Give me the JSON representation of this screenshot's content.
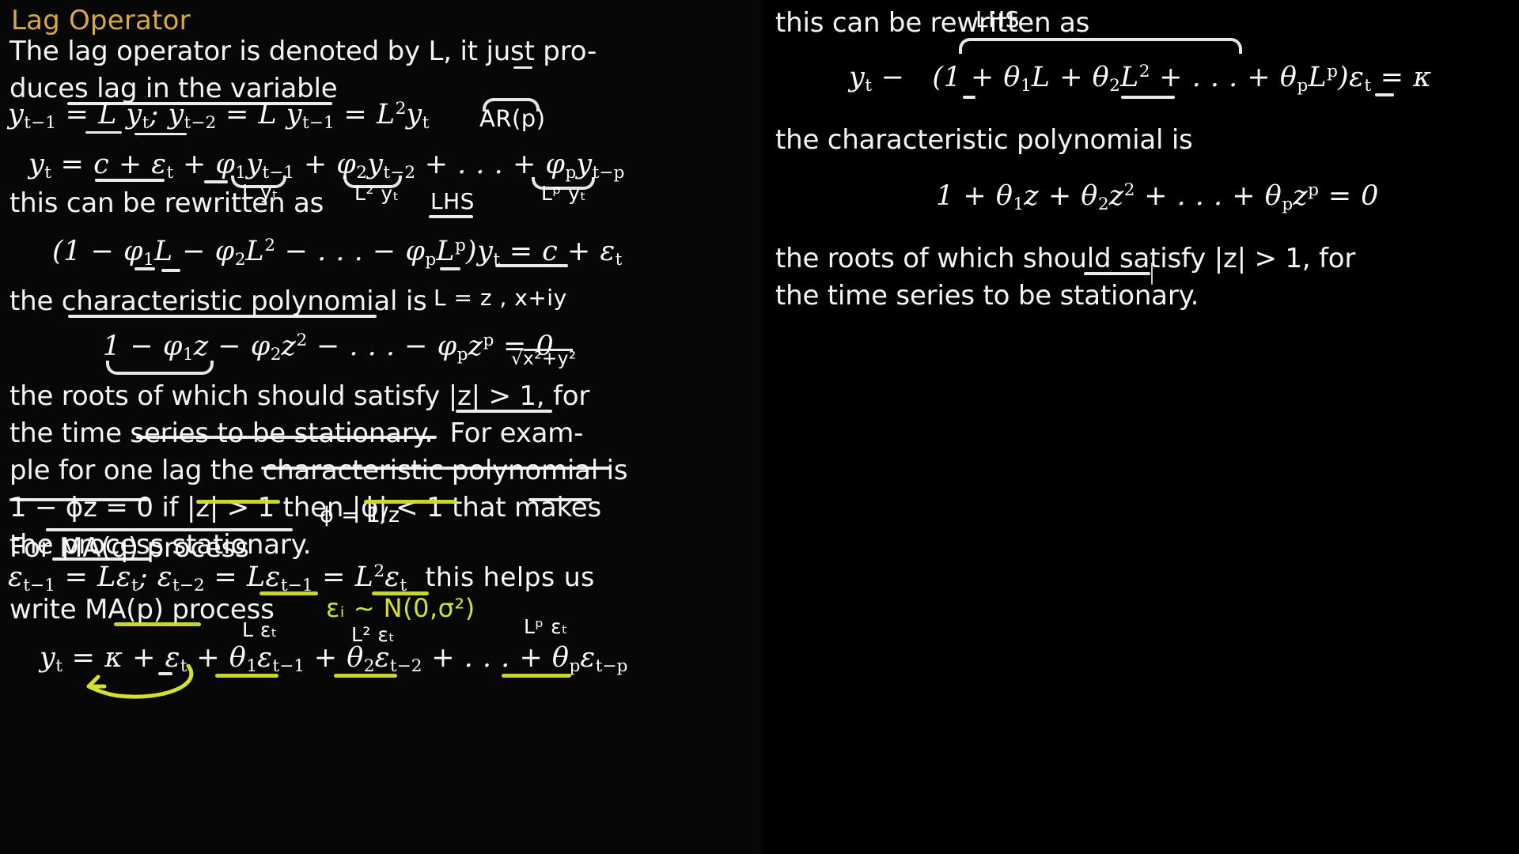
{
  "slide": {
    "title": "Lag Operator",
    "title_color": "#d9a93f",
    "background_color": "#000000",
    "text_color": "#f4f4f4",
    "annotation_white": "#ffffff",
    "annotation_yellow": "#d2e02f"
  },
  "left": {
    "p1": "The lag operator is denoted by L, it just pro-\nduces lag in the variable",
    "eq1": "y_{t-1} = L y_t ;  y_{t-2} = L y_{t-1} = L^2 y_t",
    "eq2": "y_t = c + ϵ_t + ϕ_1 y_{t-1} + ϕ_2 y_{t-2} + . . . + ϕ_p y_{t-p}",
    "p2": "this can be rewritten as",
    "eq3": "(1 − ϕ_1 L − ϕ_2 L^2 − . . . − ϕ_p L^p) y_t = c + ϵ_t",
    "p3": "the characteristic polynomial is",
    "eq4": "1 − ϕ_1 z − ϕ_2 z^2 − . . . − ϕ_p z^p = 0",
    "p4": "the roots of which should satisfy |z| > 1, for\nthe time series to be stationary.  For exam-\nple for one lag the characteristic polynomial is\n1 − ϕz = 0 if |z| > 1 then |ϕ| < 1 that makes\nthe process stationary.",
    "p5": "For MA(q) process",
    "eq5": "ϵ_{t-1} = Lϵ_t ;  ϵ_{t-2} = Lϵ_{t-1} = L^2ϵ_t  this helps us",
    "p6": "write MA(p) process",
    "eq6": "y_t = κ + ϵ_t + θ_1ϵ_{t-1} + θ_2ϵ_{t-2} + . . . + θ_pϵ_{t-p}",
    "annotations": [
      {
        "name": "ar-p-label",
        "text": "AR(p)",
        "color": "#ffffff"
      },
      {
        "name": "l-yt-label",
        "text": "L yₜ",
        "color": "#ffffff"
      },
      {
        "name": "l2-yt-label",
        "text": "L² yₜ",
        "color": "#ffffff"
      },
      {
        "name": "lp-yt-label",
        "text": "Lᵖ yₜ",
        "color": "#ffffff"
      },
      {
        "name": "lhs-label",
        "text": "LHS",
        "color": "#ffffff"
      },
      {
        "name": "l-equals-z-label",
        "text": "L = z ,   x+iy",
        "color": "#ffffff"
      },
      {
        "name": "modulus-label",
        "text": "√x²+y²",
        "color": "#ffffff"
      },
      {
        "name": "phi-equals-label",
        "text": "ϕ = 1/z",
        "color": "#ffffff"
      },
      {
        "name": "epsilon-normal-label",
        "text": "εᵢ ~ N(0,σ²)",
        "color": "#d2e02f"
      },
      {
        "name": "l-eps-label",
        "text": "L εₜ",
        "color": "#ffffff"
      },
      {
        "name": "l2-eps-label",
        "text": "L² εₜ",
        "color": "#ffffff"
      },
      {
        "name": "lp-eps-label",
        "text": "Lᵖ εₜ",
        "color": "#ffffff"
      }
    ]
  },
  "right": {
    "p1": "this can be rewritten as",
    "lhs_label": "LHS",
    "eq1": "y_t − (1 + θ_1 L + θ_2 L^2 + . . . + θ_p L^p)ϵ_t = κ",
    "p2": "the characteristic polynomial is",
    "eq2": "1 + θ_1 z + θ_2 z^2 + . . . + θ_p z^p = 0",
    "p3": "the roots of which should satisfy |z| > 1, for\nthe time series to be stationary."
  }
}
